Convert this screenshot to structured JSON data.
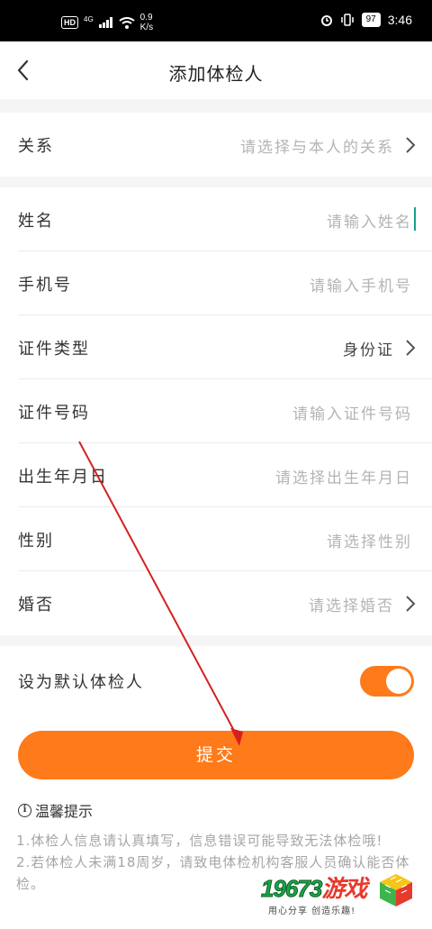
{
  "status_bar": {
    "hd": "HD",
    "network": "4G",
    "speed_value": "0.9",
    "speed_unit": "K/s",
    "battery": "97",
    "time": "3:46"
  },
  "header": {
    "title": "添加体检人"
  },
  "relation_row": {
    "label": "关系",
    "placeholder": "请选择与本人的关系"
  },
  "form": {
    "name": {
      "label": "姓名",
      "placeholder": "请输入姓名"
    },
    "phone": {
      "label": "手机号",
      "placeholder": "请输入手机号"
    },
    "id_type": {
      "label": "证件类型",
      "value": "身份证"
    },
    "id_number": {
      "label": "证件号码",
      "placeholder": "请输入证件号码"
    },
    "birthdate": {
      "label": "出生年月日",
      "placeholder": "请选择出生年月日"
    },
    "gender": {
      "label": "性别",
      "placeholder": "请选择性别"
    },
    "marital": {
      "label": "婚否",
      "placeholder": "请选择婚否"
    }
  },
  "default_toggle": {
    "label": "设为默认体检人",
    "on": true
  },
  "submit": {
    "label": "提交"
  },
  "tips": {
    "title": "温馨提示",
    "line1": "1.体检人信息请认真填写，信息错误可能导致无法体检哦!",
    "line2": "2.若体检人未满18周岁，请致电体检机构客服人员确认能否体检。"
  },
  "watermark": {
    "brand_number": "19673",
    "brand_text": "游戏",
    "slogan": "用心分享  创造乐趣!"
  },
  "colors": {
    "accent": "#ff7a1a",
    "placeholder": "#b4b4b4",
    "annotation_arrow": "#d62020",
    "cursor": "#1a9e8a"
  }
}
